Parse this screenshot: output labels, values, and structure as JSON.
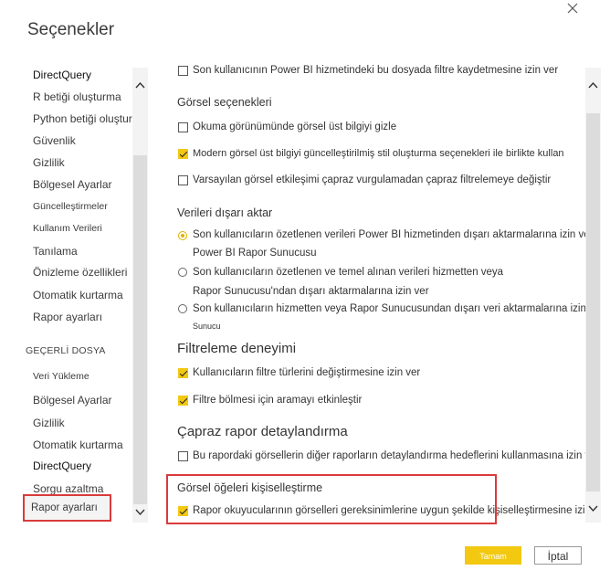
{
  "dialog": {
    "title": "Seçenekler"
  },
  "nav": {
    "global_items": [
      "DirectQuery",
      "R betiği oluşturma",
      "Python betiği oluşturma",
      "Güvenlik",
      "Gizlilik",
      "Bölgesel Ayarlar",
      "Güncelleştirmeler",
      "Kullanım Verileri",
      "Tanılama",
      "Önizleme özellikleri",
      "Otomatik kurtarma",
      "Rapor ayarları"
    ],
    "section_current_file": "GEÇERLİ DOSYA",
    "file_items": [
      "Veri Yükleme",
      "Bölgesel Ayarlar",
      "Gizlilik",
      "Otomatik kurtarma",
      "DirectQuery",
      "Sorgu azaltma",
      "Rapor ayarları"
    ],
    "selected": "Rapor ayarları"
  },
  "content": {
    "filter_save": {
      "label": "Son kullanıcının Power BI hizmetindeki bu dosyada filtre kaydetmesine izin ver",
      "checked": false
    },
    "visual_options": {
      "heading": "Görsel seçenekleri",
      "items": [
        {
          "label": "Okuma görünümünde görsel üst bilgiyi gizle",
          "checked": false
        },
        {
          "label": "Modern görsel üst bilgiyi güncelleştirilmiş stil oluşturma seçenekleri ile birlikte kullan",
          "checked": true
        },
        {
          "label": "Varsayılan görsel etkileşimi çapraz vurgulamadan çapraz filtrelemeye değiştir",
          "checked": false
        }
      ]
    },
    "export_data": {
      "heading": "Verileri dışarı aktar",
      "options": [
        {
          "line1": "Son kullanıcıların özetlenen verileri Power BI hizmetinden dışarı aktarmalarına izin ver",
          "line2": "Power BI Rapor Sunucusu",
          "selected": true
        },
        {
          "line1": "Son kullanıcıların özetlenen ve temel alınan verileri hizmetten veya",
          "line2": "Rapor Sunucusu'ndan dışarı aktarmalarına izin ver",
          "selected": false
        },
        {
          "line1": "Son kullanıcıların hizmetten veya Rapor Sunucusundan dışarı veri aktarmalarına izin verme",
          "line2": "Sunucu",
          "selected": false
        }
      ]
    },
    "filter_experience": {
      "heading": "Filtreleme deneyimi",
      "items": [
        {
          "label": "Kullanıcıların filtre türlerini değiştirmesine izin ver",
          "checked": true
        },
        {
          "label": "Filtre bölmesi için aramayı etkinleştir",
          "checked": true
        }
      ]
    },
    "cross_report": {
      "heading": "Çapraz rapor detaylandırma",
      "items": [
        {
          "label": "Bu rapordaki görsellerin diğer raporların detaylandırma hedeflerini kullanmasına izin ver",
          "checked": false
        }
      ]
    },
    "personalize": {
      "heading": "Görsel öğeleri kişiselleştirme",
      "items": [
        {
          "label": "Rapor okuyucularının görselleri gereksinimlerine uygun şekilde kişiselleştirmesine izin ver",
          "checked": true
        }
      ]
    }
  },
  "footer": {
    "ok_label": "Tamam",
    "cancel_label": "İptal"
  },
  "colors": {
    "accent": "#f2c811",
    "highlight": "#d93b3b"
  },
  "icons": {
    "close": "close-icon",
    "scroll_up": "chevron-up-icon",
    "scroll_down": "chevron-down-icon"
  }
}
